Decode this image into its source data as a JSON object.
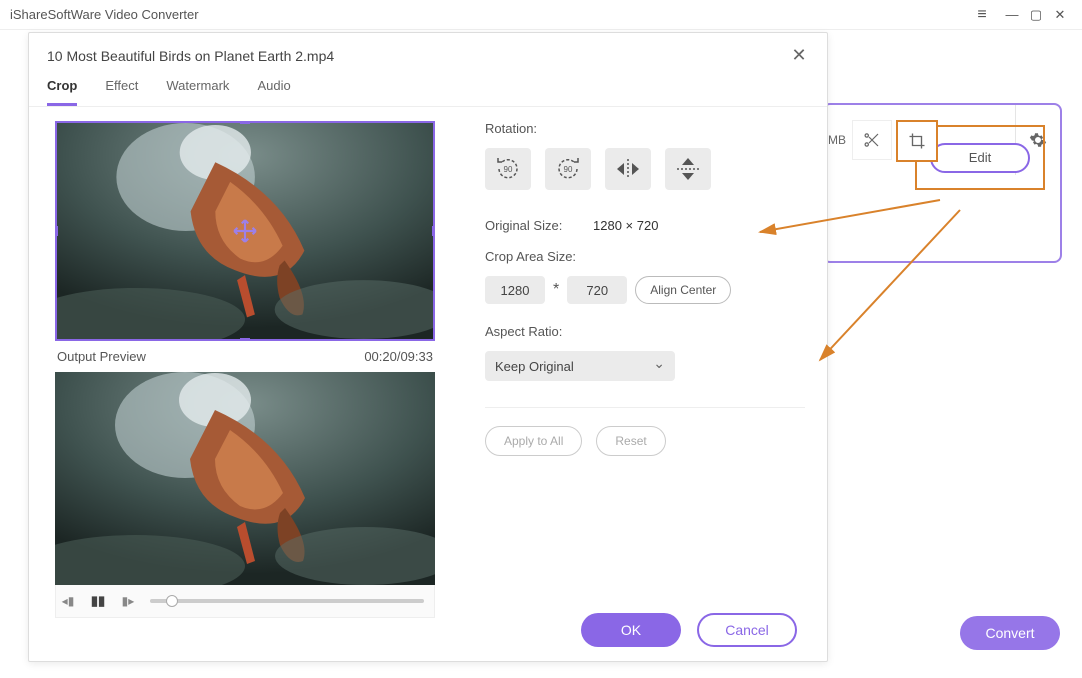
{
  "app": {
    "title": "iShareSoftWare Video Converter"
  },
  "rightpanel": {
    "size_suffix": "MB",
    "edit_label": "Edit"
  },
  "convert": {
    "label": "Convert"
  },
  "modal": {
    "title": "10 Most Beautiful Birds on Planet Earth 2.mp4",
    "tabs": {
      "crop": "Crop",
      "effect": "Effect",
      "watermark": "Watermark",
      "audio": "Audio"
    },
    "preview": {
      "label": "Output Preview",
      "time": "00:20/09:33"
    },
    "rotation_label": "Rotation:",
    "original_size_label": "Original Size:",
    "original_size_value": "1280 × 720",
    "crop_area_label": "Crop Area Size:",
    "crop_w": "1280",
    "crop_h": "720",
    "align_center": "Align Center",
    "aspect_label": "Aspect Ratio:",
    "aspect_value": "Keep Original",
    "apply_all": "Apply to All",
    "reset": "Reset",
    "ok": "OK",
    "cancel": "Cancel"
  }
}
